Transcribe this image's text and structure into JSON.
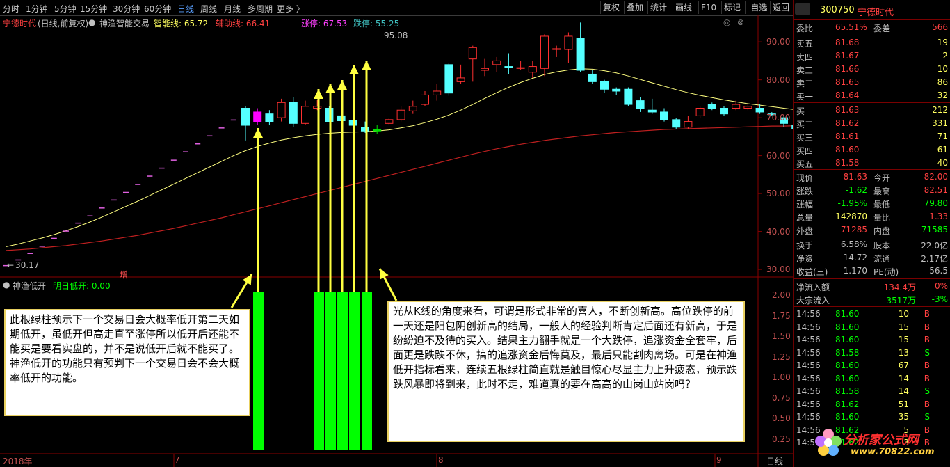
{
  "toolbar": {
    "timeframes": [
      "分时",
      "1分钟",
      "5分钟",
      "15分钟",
      "30分钟",
      "60分钟",
      "日线",
      "周线",
      "月线",
      "多周期",
      "更多 〉"
    ],
    "buttons": [
      "复权",
      "叠加",
      "统计",
      "画线",
      "F10",
      "标记",
      "-自选",
      "返回"
    ]
  },
  "legend": {
    "stock_name": "宁德时代",
    "mode": "(日线,前复权)",
    "indicator": "神渔智能交易",
    "smart_line": "智能线: 65.72",
    "aux_line": "辅助线: 66.41",
    "limit_up": "涨停: 67.53",
    "limit_down": "跌停: 55.25"
  },
  "chart": {
    "peak_label": "95.08",
    "low_label": "30.17",
    "zeng_mark": "增",
    "y_ticks_price": [
      "90.00",
      "80.00",
      "70.00",
      "60.00",
      "50.00",
      "40.00",
      "30.00"
    ],
    "y_ticks_sub": [
      "2.00",
      "1.75",
      "1.50",
      "1.25",
      "1.00",
      "0.75",
      "0.50",
      "0.25"
    ],
    "sub_indicator": "神渔低开",
    "sub_value": "明日低开: 0.00",
    "x_labels": [
      "2018年",
      "7",
      "8",
      "9"
    ],
    "period_label": "日线"
  },
  "chart_data": {
    "type": "candlestick",
    "candles": [
      [
        30.2,
        31.0,
        29.8,
        36.0
      ],
      [
        31,
        32.5,
        30.8,
        33.2
      ],
      [
        32.5,
        34.2,
        32.3,
        34.6
      ],
      [
        34.2,
        36.1,
        34,
        36.5
      ],
      [
        36,
        38.2,
        35.8,
        38.5
      ],
      [
        38,
        40.1,
        37.8,
        40.4
      ],
      [
        40,
        42.2,
        39.8,
        42.5
      ],
      [
        42,
        44.1,
        41.8,
        44.4
      ],
      [
        44,
        46.2,
        43.8,
        46.5
      ],
      [
        46,
        48.3,
        45.8,
        48.6
      ],
      [
        48.5,
        50.3,
        48.2,
        50.6
      ],
      [
        50.5,
        52.4,
        50.2,
        52.8
      ],
      [
        52.4,
        54.6,
        52.1,
        54.9
      ],
      [
        54.5,
        56.7,
        54.2,
        57.0
      ],
      [
        56.5,
        58.8,
        56.2,
        59.1
      ],
      [
        59,
        61.0,
        58.7,
        61.3
      ],
      [
        61,
        63.1,
        60.7,
        63.4
      ],
      [
        63,
        65.2,
        62.7,
        65.5
      ],
      [
        65,
        67.3,
        64.7,
        67.6
      ],
      [
        67,
        69.4,
        66.7,
        69.7
      ],
      [
        72.5,
        68,
        64,
        73
      ],
      [
        69,
        71.5,
        68,
        72.5
      ],
      [
        71,
        69,
        68,
        72
      ],
      [
        70,
        74,
        69,
        75
      ],
      [
        74,
        68.5,
        67.5,
        75.5
      ],
      [
        68.5,
        73,
        68,
        74.5
      ],
      [
        72.5,
        73,
        72,
        74.8
      ],
      [
        72.5,
        69,
        68.8,
        73
      ],
      [
        70.5,
        69.2,
        68.8,
        71
      ],
      [
        69.2,
        68,
        67.5,
        69.8
      ],
      [
        67.5,
        66.5,
        66,
        69
      ],
      [
        66.5,
        67,
        65.8,
        68
      ],
      [
        68.5,
        69.5,
        68,
        70
      ],
      [
        69.5,
        72,
        69,
        73
      ],
      [
        71.8,
        73,
        71,
        74.5
      ],
      [
        73.5,
        76,
        73,
        77
      ],
      [
        76,
        77,
        74.5,
        79
      ],
      [
        84,
        76.5,
        75.8,
        84.5
      ],
      [
        79.5,
        80.5,
        79,
        84
      ],
      [
        85.5,
        88.5,
        79.5,
        89
      ],
      [
        82.5,
        83,
        81,
        85.5
      ],
      [
        84,
        85,
        82,
        86
      ],
      [
        83.5,
        83.2,
        81.5,
        87
      ],
      [
        83,
        83.2,
        82.5,
        85
      ],
      [
        82,
        83.5,
        80.5,
        85
      ],
      [
        83,
        91.5,
        81,
        92
      ],
      [
        88,
        88.2,
        86,
        89
      ],
      [
        88,
        91.5,
        84.5,
        92.5
      ],
      [
        91,
        82.5,
        82,
        95.1
      ],
      [
        81.5,
        79.5,
        79,
        82.5
      ],
      [
        79.5,
        77.5,
        76.5,
        80
      ],
      [
        77.5,
        77,
        76,
        78
      ],
      [
        77.5,
        73.5,
        73,
        78
      ],
      [
        74.5,
        72.5,
        71.5,
        75.5
      ],
      [
        72,
        71.5,
        71,
        75
      ],
      [
        71.5,
        69.5,
        69,
        72.5
      ],
      [
        69.5,
        67.5,
        67,
        70
      ],
      [
        67.5,
        69,
        67,
        70.5
      ],
      [
        70.5,
        72.5,
        70,
        73
      ],
      [
        73.5,
        72.5,
        72,
        74
      ],
      [
        72.5,
        71,
        70.5,
        73
      ],
      [
        72.5,
        73.5,
        72,
        74.5
      ],
      [
        72.5,
        73,
        72,
        73.5
      ],
      [
        72.5,
        71.5,
        71,
        73.5
      ],
      [
        71,
        70.8,
        70.5,
        71.5
      ],
      [
        70,
        68.5,
        67.5,
        70.5
      ],
      [
        68,
        67,
        66.5,
        68.5
      ],
      [
        66.5,
        68.8,
        66.2,
        69.2
      ],
      [
        67.5,
        68.5,
        67.2,
        69.5
      ],
      [
        68,
        69.5,
        67.8,
        70
      ],
      [
        69,
        69.5,
        68.8,
        69.8
      ],
      [
        67.5,
        68.5,
        67,
        69
      ],
      [
        67.8,
        68.5,
        67.5,
        70
      ],
      [
        68,
        69,
        67.5,
        71
      ],
      [
        69,
        70.5,
        68.5,
        71
      ],
      [
        70,
        71,
        69.5,
        72
      ],
      [
        71,
        72.5,
        70.5,
        74
      ],
      [
        72,
        73.5,
        71.5,
        75
      ],
      [
        73,
        72,
        71.5,
        74
      ],
      [
        73,
        70.5,
        70,
        74
      ],
      [
        67.5,
        65.5,
        65,
        68
      ],
      [
        64.5,
        62.5,
        61.8,
        65.5
      ],
      [
        63,
        63.5,
        62.8,
        64
      ],
      [
        63.5,
        61.5,
        61,
        64
      ],
      [
        62,
        61.5,
        60.8,
        63
      ]
    ],
    "smart_line": [
      36,
      36.7,
      37.5,
      38.3,
      39.2,
      40.2,
      41.3,
      42.5,
      43.8,
      45.2,
      46.6,
      48,
      49.5,
      51,
      52.5,
      54,
      55.5,
      57,
      58.5,
      60,
      61.3,
      62.4,
      63.3,
      64.1,
      64.7,
      65.2,
      65.6,
      65.9,
      66.1,
      66.2,
      66.3,
      66.5,
      66.8,
      67.3,
      67.9,
      68.7,
      69.6,
      70.7,
      72,
      73.5,
      75.1,
      76.6,
      78,
      79.3,
      80.4,
      81.4,
      82.1,
      82.6,
      82.9,
      82.8,
      82.4,
      81.8,
      81,
      80.1,
      79.2,
      78.3,
      77.4,
      76.6,
      75.9,
      75.3,
      74.7,
      74.2,
      73.7,
      73.3,
      72.9,
      72.5,
      72.1,
      71.7,
      71.3,
      70.9,
      70.6,
      70.3,
      70.1,
      70,
      70,
      70.1,
      70.3,
      70.5,
      70.6,
      70.5,
      70,
      69.2,
      68.3,
      67.4,
      66.5
    ],
    "aux_line": [
      35,
      35.2,
      35.4,
      35.7,
      36,
      36.3,
      36.7,
      37.1,
      37.5,
      38,
      38.5,
      39,
      39.6,
      40.2,
      40.8,
      41.5,
      42.2,
      42.9,
      43.6,
      44.4,
      45.2,
      46,
      46.8,
      47.6,
      48.4,
      49.2,
      50,
      50.8,
      51.6,
      52.4,
      53.2,
      54,
      54.8,
      55.6,
      56.4,
      57.2,
      58,
      58.8,
      59.6,
      60.4,
      61.1,
      61.8,
      62.4,
      63,
      63.5,
      64,
      64.4,
      64.8,
      65.2,
      65.5,
      65.8,
      66.1,
      66.3,
      66.5,
      66.7,
      66.9,
      67,
      67.1,
      67.2,
      67.3,
      67.4,
      67.5,
      67.6,
      67.7,
      67.8,
      67.8,
      67.9,
      67.9,
      68,
      68,
      68,
      68,
      68,
      68,
      68,
      68,
      68,
      68,
      67.9,
      67.8,
      67.6,
      67.3,
      67,
      66.7,
      66.4
    ],
    "ylim": [
      28,
      97
    ],
    "green_bars_at": [
      21,
      27,
      28,
      29,
      30,
      31
    ]
  },
  "panel": {
    "code": "300750",
    "name": "宁德时代",
    "weibi_label": "委比",
    "weibi": "65.51%",
    "weicha_label": "委差",
    "weicha": "566",
    "asks": [
      {
        "label": "卖五",
        "price": "81.68",
        "vol": "19"
      },
      {
        "label": "卖四",
        "price": "81.67",
        "vol": "2"
      },
      {
        "label": "卖三",
        "price": "81.66",
        "vol": "10"
      },
      {
        "label": "卖二",
        "price": "81.65",
        "vol": "86"
      },
      {
        "label": "卖一",
        "price": "81.64",
        "vol": "32"
      }
    ],
    "bids": [
      {
        "label": "买一",
        "price": "81.63",
        "vol": "212"
      },
      {
        "label": "买二",
        "price": "81.62",
        "vol": "331"
      },
      {
        "label": "买三",
        "price": "81.61",
        "vol": "71"
      },
      {
        "label": "买四",
        "price": "81.60",
        "vol": "61"
      },
      {
        "label": "买五",
        "price": "81.58",
        "vol": "40"
      }
    ],
    "stats": [
      {
        "l1": "现价",
        "v1": "81.63",
        "l2": "今开",
        "v2": "82.00"
      },
      {
        "l1": "涨跌",
        "v1": "-1.62",
        "l2": "最高",
        "v2": "82.51"
      },
      {
        "l1": "涨幅",
        "v1": "-1.95%",
        "l2": "最低",
        "v2": "79.80"
      },
      {
        "l1": "总量",
        "v1": "142870",
        "l2": "量比",
        "v2": "1.33"
      },
      {
        "l1": "外盘",
        "v1": "71285",
        "l2": "内盘",
        "v2": "71585"
      }
    ],
    "stats2": [
      {
        "l1": "换手",
        "v1": "6.58%",
        "l2": "股本",
        "v2": "22.0亿"
      },
      {
        "l1": "净资",
        "v1": "14.72",
        "l2": "流通",
        "v2": "2.17亿"
      },
      {
        "l1": "收益(三)",
        "v1": "1.170",
        "l2": "PE(动)",
        "v2": "56.5"
      }
    ],
    "flows": [
      {
        "label": "净流入额",
        "value": "134.4万",
        "pct": "0%"
      },
      {
        "label": "大宗流入",
        "value": "-3517万",
        "pct": "-3%"
      }
    ],
    "ticks": [
      {
        "t": "14:56",
        "p": "81.60",
        "v": "10",
        "s": "B"
      },
      {
        "t": "14:56",
        "p": "81.60",
        "v": "15",
        "s": "B"
      },
      {
        "t": "14:56",
        "p": "81.60",
        "v": "15",
        "s": "B"
      },
      {
        "t": "14:56",
        "p": "81.58",
        "v": "13",
        "s": "S"
      },
      {
        "t": "14:56",
        "p": "81.60",
        "v": "67",
        "s": "B"
      },
      {
        "t": "14:56",
        "p": "81.60",
        "v": "14",
        "s": "B"
      },
      {
        "t": "14:56",
        "p": "81.58",
        "v": "14",
        "s": "S"
      },
      {
        "t": "14:56",
        "p": "81.62",
        "v": "51",
        "s": "B"
      },
      {
        "t": "14:56",
        "p": "81.60",
        "v": "35",
        "s": "S"
      },
      {
        "t": "14:56",
        "p": "81.62",
        "v": "5",
        "s": "B"
      },
      {
        "t": "14:56",
        "p": "81.62",
        "v": "3",
        "s": "B"
      }
    ],
    "watermark": "分析家公式网",
    "watermark_url": "www.70822.com"
  },
  "annotations": {
    "left": "此根绿柱预示下一个交易日会大概率低开第二天如期低开，虽低开但高走直至涨停所以低开后还能不能买是要看实盘的，并不是说低开后就不能买了。神渔低开的功能只有预判下一个交易日会不会大概率低开的功能。",
    "right": "光从K线的角度来看，可谓是形式非常的喜人，不断创新高。高位跌停的前一天还是阳包阴创新高的结局，一般人的经验判断肯定后面还有新高，于是纷纷迫不及待的买入。结果主力翻手就是一个大跌停，追涨资金全套牢，后面更是跌跌不休，搞的追涨资金后悔莫及，最后只能割肉离场。可是在神渔低开指标看来，连续五根绿柱简直就是触目惊心尽显主力上升疲态，预示跌跌风暴即将到来，此时不走，难道真的要在高高的山岗山站岗吗？"
  },
  "colors": {
    "up": "#ff3030",
    "down": "#54ffff",
    "accent": "#5aa0ff",
    "green": "#00ff00",
    "yellow": "#ffff40",
    "magenta": "#ff00ff",
    "sma": "#ffff80",
    "ema": "#c02020"
  }
}
